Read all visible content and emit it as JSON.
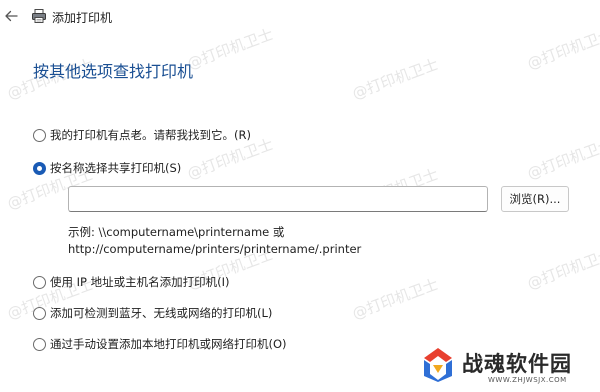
{
  "window": {
    "title": "添加打印机"
  },
  "icons": {
    "back": "arrow-left-icon",
    "printer": "printer-icon",
    "logo": "battle-soul-logo-mark"
  },
  "heading": "按其他选项查找打印机",
  "options": [
    {
      "label": "我的打印机有点老。请帮我找到它。(R)",
      "checked": false
    },
    {
      "label": "按名称选择共享打印机(S)",
      "checked": true
    },
    {
      "label": "使用 IP 地址或主机名添加打印机(I)",
      "checked": false
    },
    {
      "label": "添加可检测到蓝牙、无线或网络的打印机(L)",
      "checked": false
    },
    {
      "label": "通过手动设置添加本地打印机或网络打印机(O)",
      "checked": false
    }
  ],
  "printer_name_input": {
    "value": "",
    "placeholder": ""
  },
  "browse_button": "浏览(R)...",
  "example": {
    "line1": "示例: \\\\computername\\printername 或",
    "line2": "http://computername/printers/printername/.printer"
  },
  "watermark_text": "@打印机卫士",
  "logo": {
    "name": "战魂软件园",
    "url": "WWW.ZHJWSJX.COM"
  },
  "colors": {
    "heading": "#1a4f93",
    "accent": "#1a5bb5"
  }
}
